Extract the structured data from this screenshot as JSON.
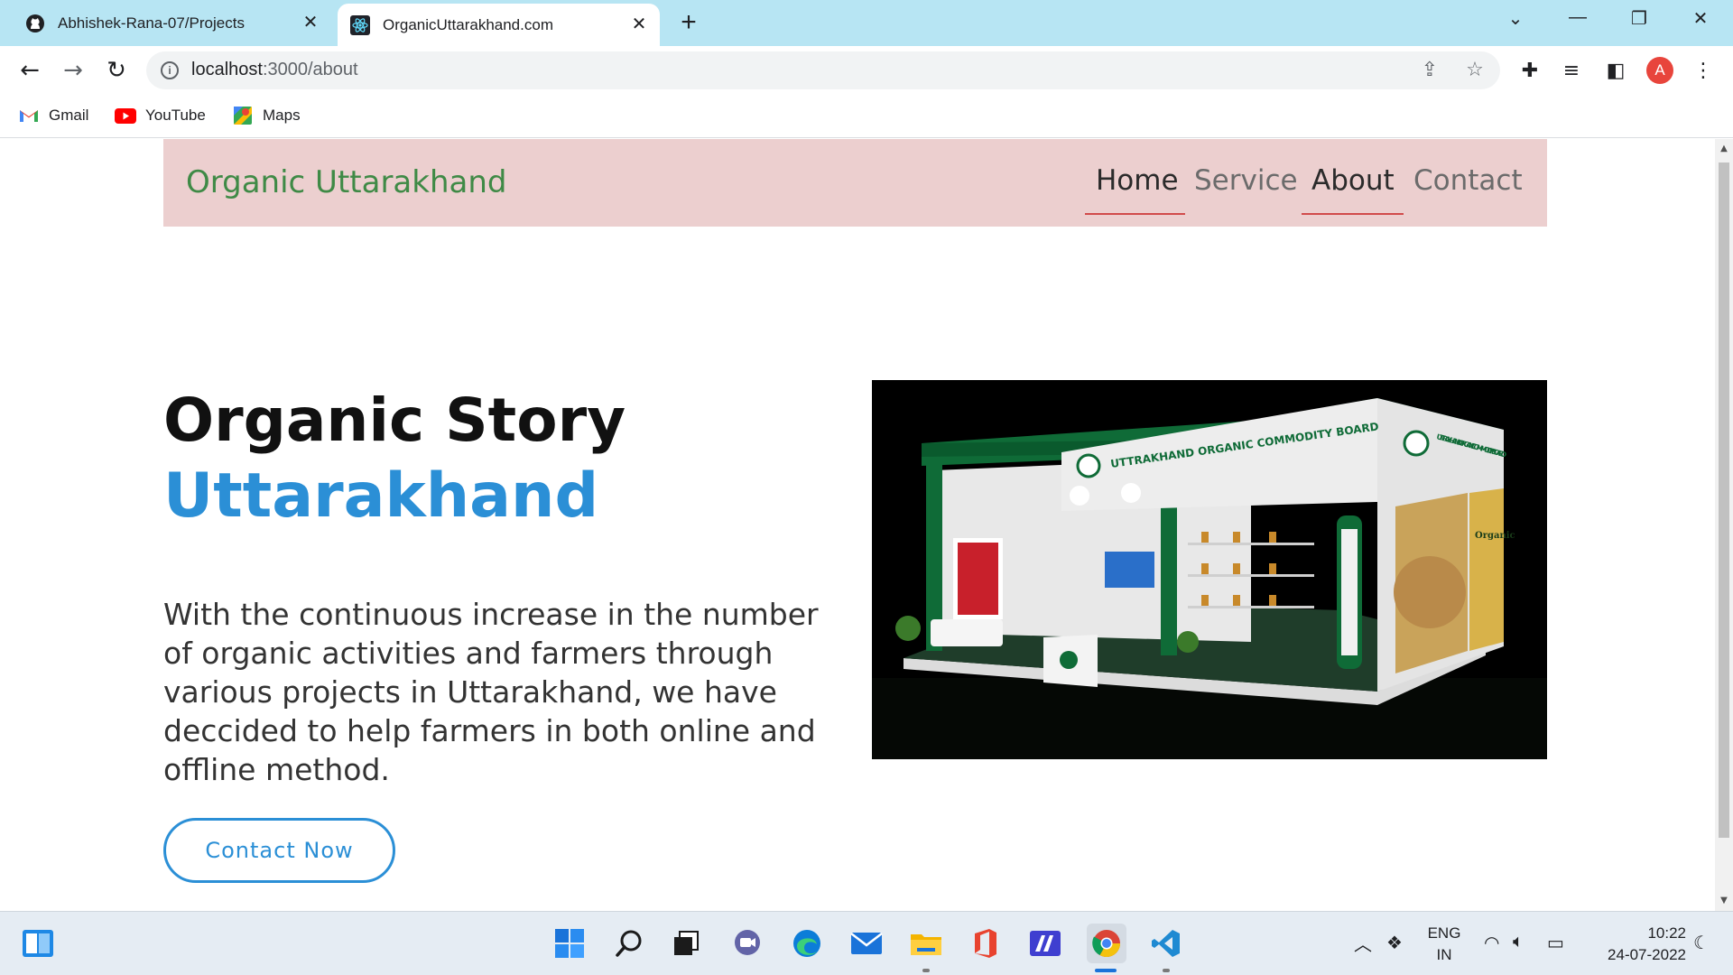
{
  "browser": {
    "tabs": [
      {
        "title": "Abhishek-Rana-07/Projects",
        "icon": "github-icon",
        "active": false
      },
      {
        "title": "OrganicUttarakhand.com",
        "icon": "react-icon",
        "active": true
      }
    ],
    "new_tab": "+",
    "address": {
      "host": "localhost",
      "path": ":3000/about"
    },
    "bookmarks": [
      {
        "label": "Gmail",
        "icon": "gmail-icon"
      },
      {
        "label": "YouTube",
        "icon": "youtube-icon"
      },
      {
        "label": "Maps",
        "icon": "maps-icon"
      }
    ],
    "profile_initial": "A"
  },
  "site": {
    "brand": "Organic Uttarakhand",
    "nav": [
      {
        "label": "Home",
        "active": true
      },
      {
        "label": "Service",
        "active": false
      },
      {
        "label": "About",
        "active": true
      },
      {
        "label": "Contact",
        "active": false
      }
    ],
    "hero": {
      "title": "Organic Story",
      "subtitle": "Uttarakhand",
      "paragraph": "With the continuous increase in the number of organic activities and farmers through various projects in Uttarakhand, we have deccided to help farmers in both online and offline method.",
      "cta": "Contact Now"
    },
    "image": {
      "banner_front": "UTTRAKHAND ORGANIC COMMODITY BOARD",
      "banner_side": "UTTRAKHAND ORGANIC COMMODITY BOARD",
      "panel_word": "Organic"
    },
    "colors": {
      "nav_bg": "#eccfcf",
      "brand": "#3f8a46",
      "accent": "#2b8fd6",
      "underline": "#d14b4b"
    }
  },
  "taskbar": {
    "language": "ENG",
    "region": "IN",
    "time": "10:22",
    "date": "24-07-2022",
    "apps": [
      "windows-start-icon",
      "search-icon",
      "task-view-icon",
      "teams-chat-icon",
      "edge-icon",
      "mail-icon",
      "file-explorer-icon",
      "office-icon",
      "app-icon",
      "chrome-icon",
      "vscode-icon"
    ]
  }
}
